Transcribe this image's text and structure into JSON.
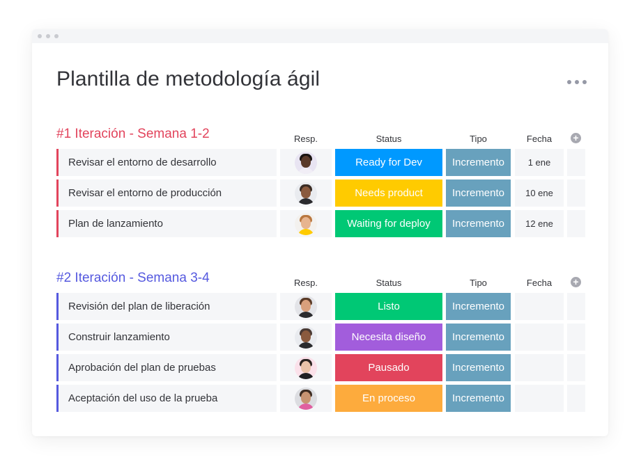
{
  "window": {
    "controls": [
      "window-dot",
      "window-dot",
      "window-dot"
    ]
  },
  "page": {
    "title": "Plantilla de metodología ágil",
    "more_menu_icon": "more-horizontal-icon"
  },
  "columns": {
    "resp": "Resp.",
    "status": "Status",
    "tipo": "Tipo",
    "fecha": "Fecha",
    "add_icon": "plus-circle-icon"
  },
  "groups": [
    {
      "title": "#1 Iteración - Semana 1-2",
      "color": "#e2445c",
      "rows": [
        {
          "name": "Revisar el entorno de desarrollo",
          "avatar": {
            "skin": "#5a3a2a",
            "hair": "#1a1412",
            "body": "#f1eef6",
            "bg": "#e8e4f2"
          },
          "status": "Ready for Dev",
          "status_color": "#0099ff",
          "tipo": "Incremento",
          "fecha": "1 ene"
        },
        {
          "name": "Revisar el entorno de producción",
          "avatar": {
            "skin": "#8a5a3e",
            "hair": "#3a2c24",
            "body": "#2b2b2e",
            "bg": "#e9ebef"
          },
          "status": "Needs product",
          "status_color": "#ffcb00",
          "tipo": "Incremento",
          "fecha": "10 ene"
        },
        {
          "name": "Plan de lanzamiento",
          "avatar": {
            "skin": "#e7b48f",
            "hair": "#b9773f",
            "body": "#ffcb00",
            "bg": "#f3f1ee"
          },
          "status": "Waiting for deploy",
          "status_color": "#00c875",
          "tipo": "Incremento",
          "fecha": "12 ene"
        }
      ]
    },
    {
      "title": "#2 Iteración - Semana 3-4",
      "color": "#5559df",
      "rows": [
        {
          "name": "Revisión del plan de liberación",
          "avatar": {
            "skin": "#d9a07c",
            "hair": "#5a3a26",
            "body": "#2b2b2e",
            "bg": "#e3e4e8"
          },
          "status": "Listo",
          "status_color": "#00c875",
          "tipo": "Incremento",
          "fecha": ""
        },
        {
          "name": "Construir lanzamiento",
          "avatar": {
            "skin": "#8a5a3e",
            "hair": "#4a3a34",
            "body": "#2b2b2e",
            "bg": "#e9ebef"
          },
          "status": "Necesita diseño",
          "status_color": "#a25ddc",
          "tipo": "Incremento",
          "fecha": ""
        },
        {
          "name": "Aprobación del plan de pruebas",
          "avatar": {
            "skin": "#e9c2a8",
            "hair": "#2a2320",
            "body": "#1f1f22",
            "bg": "#fbe1ea"
          },
          "status": "Pausado",
          "status_color": "#e2445c",
          "tipo": "Incremento",
          "fecha": ""
        },
        {
          "name": "Aceptación del uso de la prueba",
          "avatar": {
            "skin": "#c89472",
            "hair": "#3d2c22",
            "body": "#e05fa0",
            "bg": "#dcdde1"
          },
          "status": "En proceso",
          "status_color": "#fdab3d",
          "tipo": "Incremento",
          "fecha": ""
        }
      ]
    }
  ]
}
